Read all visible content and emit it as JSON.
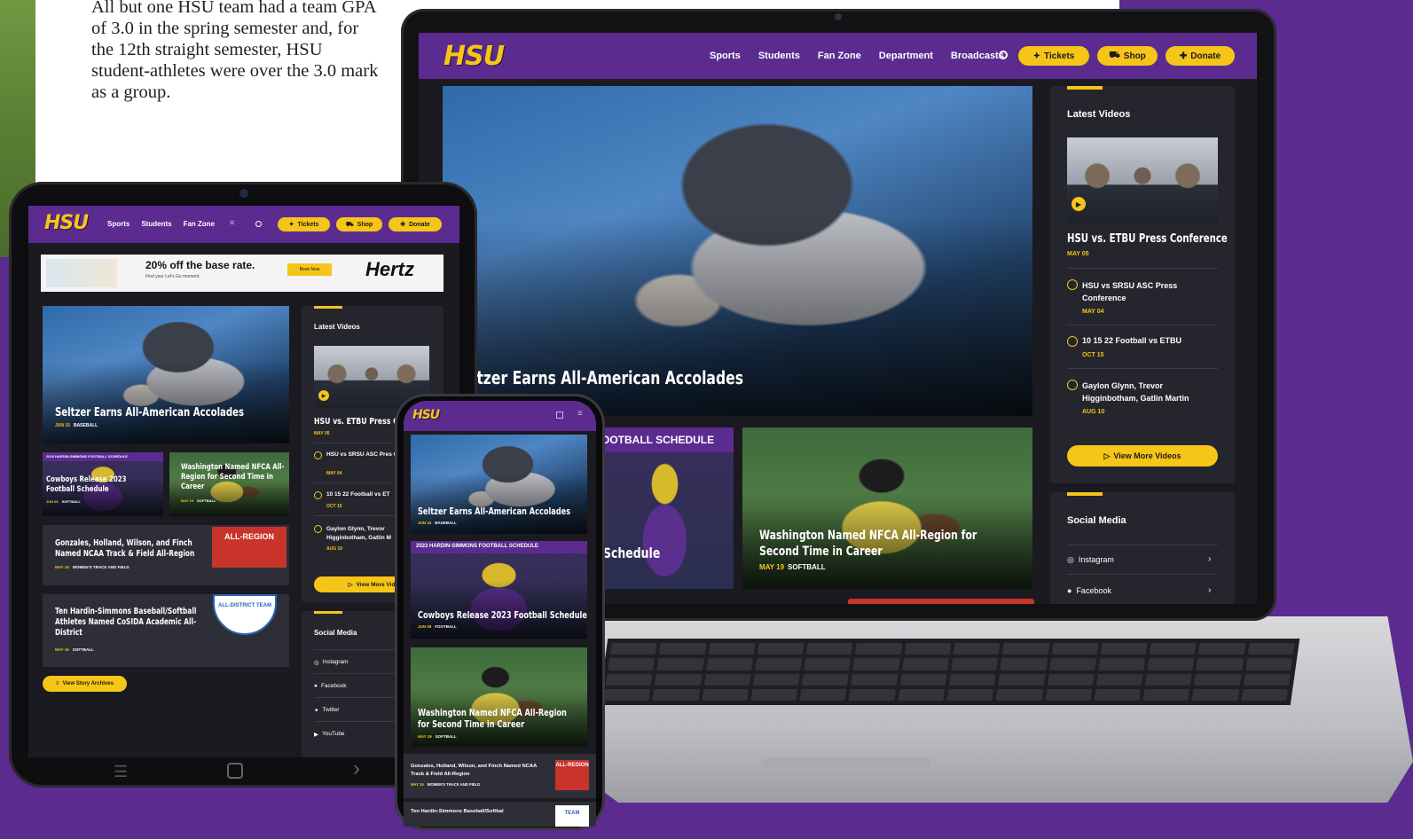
{
  "article": {
    "text": "All but one HSU team had a team GPA of 3.0 in the spring semester and, for the 12th straight semester, HSU student-athletes were over the 3.0 mark as a group."
  },
  "brand": {
    "logo": "HSU",
    "colors": {
      "purple": "#5b2b8f",
      "gold": "#f5c518",
      "dark": "#1a1a20"
    }
  },
  "laptop": {
    "nav": [
      "Sports",
      "Students",
      "Fan Zone",
      "Department",
      "Broadcasts"
    ],
    "search_icon": "search-icon",
    "buttons": {
      "tickets": "Tickets",
      "shop": "Shop",
      "donate": "Donate"
    },
    "hero": {
      "title": "ltzer Earns All-American Accolades"
    },
    "story2": {
      "banner": "OOTBALL SCHEDULE",
      "title": "Schedule"
    },
    "story3": {
      "title": "Washington Named NFCA All-Region for Second Time in Career",
      "date": "MAY 19",
      "sport": "SOFTBALL"
    },
    "videos": {
      "heading": "Latest Videos",
      "featured": {
        "title": "HSU vs. ETBU Press Conference",
        "date": "MAY 05"
      },
      "items": [
        {
          "title": "HSU vs SRSU ASC Press Conference",
          "date": "MAY 04"
        },
        {
          "title": "10 15 22 Football vs ETBU",
          "date": "OCT 15"
        },
        {
          "title": "Gaylon Glynn, Trevor Higginbotham, Gatlin Martin",
          "date": "AUG 10"
        }
      ],
      "more": "View More Videos"
    },
    "social": {
      "heading": "Social Media",
      "items": [
        "Instagram",
        "Facebook"
      ]
    }
  },
  "tablet": {
    "nav": [
      "Sports",
      "Students",
      "Fan Zone"
    ],
    "buttons": {
      "tickets": "Tickets",
      "shop": "Shop",
      "donate": "Donate"
    },
    "ad": {
      "headline": "20% off the base rate.",
      "sub": "Find your Let's Go moment.",
      "cta": "Book Now",
      "brand": "Hertz"
    },
    "hero": {
      "title": "Seltzer Earns All-American Accolades",
      "date": "JUN 15",
      "sport": "BASEBALL"
    },
    "tile1": {
      "banner": "2023 HARDIN-SIMMONS FOOTBALL SCHEDULE",
      "title": "Cowboys Release 2023 Football Schedule",
      "date": "JUN 08",
      "sport": "SOFTBALL"
    },
    "tile2": {
      "title": "Washington Named NFCA All-Region for Second Time in Career",
      "date": "MAY 19",
      "sport": "SOFTBALL"
    },
    "list": [
      {
        "title": "Gonzales, Holland, Wilson, and Finch Named NCAA Track & Field All-Region",
        "date": "MAY 19",
        "sport": "WOMEN'S TRACK AND FIELD",
        "badge": "ALL-REGION"
      },
      {
        "title": "Ten Hardin-Simmons Baseball/Softball Athletes Named CoSIDA Academic All-District",
        "date": "MAY 16",
        "sport": "SOFTBALL",
        "badge": "ALL-DISTRICT TEAM"
      }
    ],
    "archives": "View Story Archives",
    "videos": {
      "heading": "Latest Videos",
      "featured": {
        "title": "HSU vs. ETBU Press Conf",
        "date": "MAY 05"
      },
      "items": [
        {
          "title": "HSU vs SRSU ASC Pres Conference",
          "date": "MAY 04"
        },
        {
          "title": "10 15 22 Football vs ET",
          "date": "OCT 15"
        },
        {
          "title": "Gaylon Glynn, Trevor Higginbotham, Gatlin M",
          "date": "AUG 10"
        }
      ],
      "more": "View More Vid"
    },
    "social": {
      "heading": "Social Media",
      "items": [
        "Instagram",
        "Facebook",
        "Twitter",
        "YouTube"
      ]
    }
  },
  "phone": {
    "stories": [
      {
        "title": "Seltzer Earns All-American Accolades",
        "date": "JUN 15",
        "sport": "BASEBALL"
      },
      {
        "banner": "2023 HARDIN-SIMMONS FOOTBALL SCHEDULE",
        "title": "Cowboys Release 2023 Football Schedule",
        "date": "JUN 08",
        "sport": "FOOTBALL"
      },
      {
        "title": "Washington Named NFCA All-Region for Second Time in Career",
        "date": "MAY 19",
        "sport": "SOFTBALL"
      }
    ],
    "list": [
      {
        "title": "Gonzales, Holland, Wilson, and Finch Named NCAA Track & Field All-Region",
        "date": "MAY 19",
        "sport": "WOMEN'S TRACK AND FIELD",
        "badge": "ALL-REGION"
      },
      {
        "title": "Ten Hardin-Simmons Baseball/Softbal",
        "badge": "TEAM"
      }
    ]
  }
}
